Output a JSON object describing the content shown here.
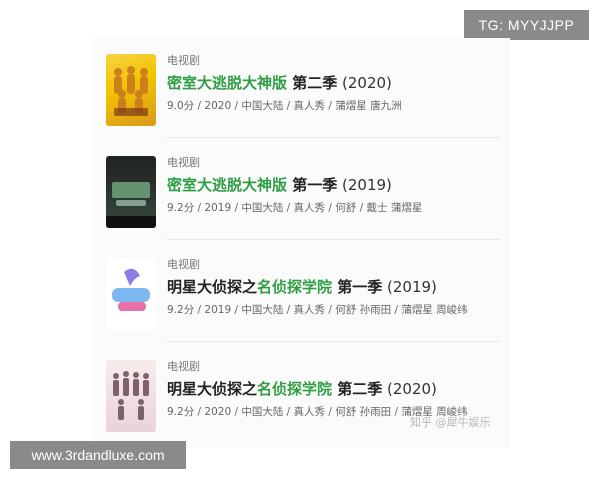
{
  "overlay": {
    "tg_label": "TG: MYYJJPP",
    "site_label": "www.3rdandluxe.com",
    "watermark": "知乎 @犀牛娱乐"
  },
  "results": [
    {
      "type": "电视剧",
      "title_highlight": "密室大逃脱大神版",
      "title_rest": " 第二季",
      "year": " (2020)",
      "info": "9.0分 / 2020 / 中国大陆 / 真人秀 / 蒲熠星 唐九洲",
      "poster_colors": [
        "#f2c500",
        "#c9791e"
      ]
    },
    {
      "type": "电视剧",
      "title_highlight": "密室大逃脱大神版",
      "title_rest": " 第一季",
      "year": " (2019)",
      "info": "9.2分 / 2019 / 中国大陆 / 真人秀 / 何舒 / 戴士 蒲熠星",
      "poster_colors": [
        "#2a2f2c",
        "#4c6b52"
      ]
    },
    {
      "type": "电视剧",
      "title_prefix": "明星大侦探之",
      "title_highlight": "名侦探学院",
      "title_rest": " 第一季",
      "year": " (2019)",
      "info": "9.2分 / 2019 / 中国大陆 / 真人秀 / 何舒 孙雨田 / 蒲熠星 周峻纬",
      "poster_colors": [
        "#e9eef9",
        "#7f6be0"
      ]
    },
    {
      "type": "电视剧",
      "title_prefix": "明星大侦探之",
      "title_highlight": "名侦探学院",
      "title_rest": " 第二季",
      "year": " (2020)",
      "info": "9.2分 / 2020 / 中国大陆 / 真人秀 / 何舒 孙雨田 / 蒲熠星 周峻纬",
      "poster_colors": [
        "#f4e6e6",
        "#b58fa3"
      ]
    }
  ]
}
